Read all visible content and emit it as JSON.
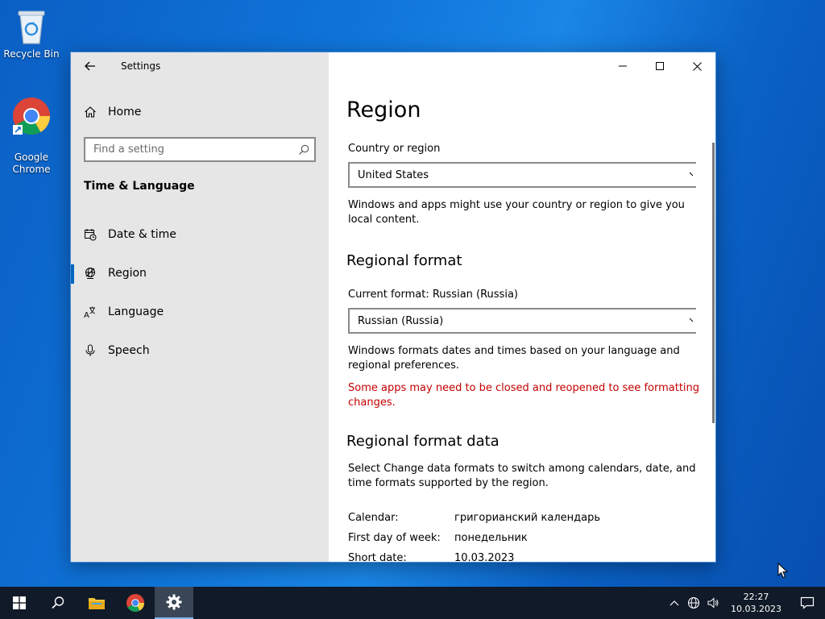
{
  "desktop": {
    "icons": [
      {
        "label": "Recycle Bin"
      },
      {
        "label": "Google\nChrome"
      }
    ]
  },
  "window": {
    "app_title": "Settings",
    "sidebar": {
      "home_label": "Home",
      "search_placeholder": "Find a setting",
      "section_title": "Time & Language",
      "items": [
        {
          "label": "Date & time",
          "icon": "calendar-clock-icon"
        },
        {
          "label": "Region",
          "icon": "globe-icon",
          "selected": true
        },
        {
          "label": "Language",
          "icon": "language-icon"
        },
        {
          "label": "Speech",
          "icon": "microphone-icon"
        }
      ]
    },
    "main": {
      "title": "Region",
      "country_label": "Country or region",
      "country_value": "United States",
      "country_desc": "Windows and apps might use your country or region to give you local content.",
      "regional_format_heading": "Regional format",
      "current_format_label": "Current format: Russian (Russia)",
      "format_value": "Russian (Russia)",
      "format_desc": "Windows formats dates and times based on your language and regional preferences.",
      "format_warning": "Some apps may need to be closed and reopened to see formatting changes.",
      "format_data_heading": "Regional format data",
      "format_data_desc": "Select Change data formats to switch among calendars, date, and time formats supported by the region.",
      "format_data": [
        {
          "key": "Calendar:",
          "value": "григорианский календарь"
        },
        {
          "key": "First day of week:",
          "value": "понедельник"
        },
        {
          "key": "Short date:",
          "value": "10.03.2023"
        }
      ]
    }
  },
  "taskbar": {
    "time": "22:27",
    "date": "10.03.2023"
  },
  "colors": {
    "accent": "#0067c0",
    "warning": "#c40000",
    "sidebar_bg": "#e6e6e6",
    "taskbar_bg": "#101a28"
  }
}
